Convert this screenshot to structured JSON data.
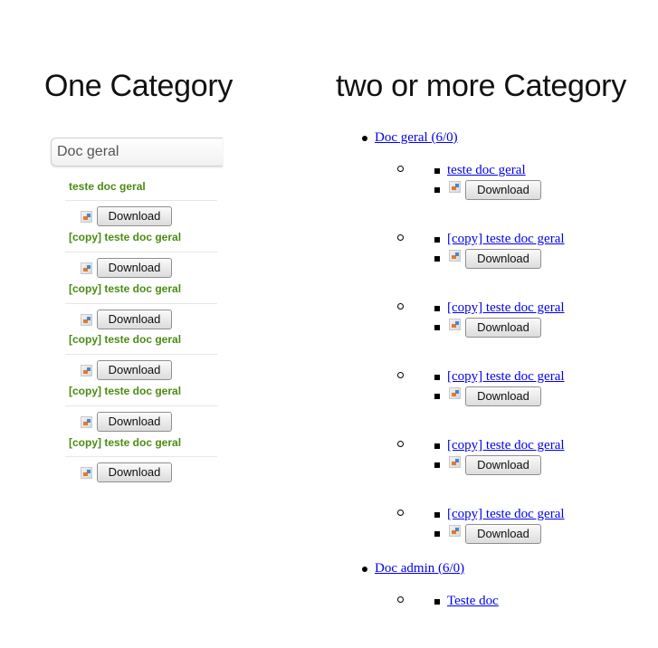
{
  "headings": {
    "one": "One Category",
    "two": "two or more Category"
  },
  "left": {
    "category": "Doc geral",
    "docs": [
      {
        "title": "teste doc geral",
        "button": "Download"
      },
      {
        "title": "[copy] teste doc geral",
        "button": "Download"
      },
      {
        "title": "[copy] teste doc geral",
        "button": "Download"
      },
      {
        "title": "[copy] teste doc geral",
        "button": "Download"
      },
      {
        "title": "[copy] teste doc geral",
        "button": "Download"
      },
      {
        "title": "[copy] teste doc geral",
        "button": "Download"
      }
    ]
  },
  "right": {
    "categories": [
      {
        "label": "Doc geral (6/0)",
        "docs": [
          {
            "title": "teste doc geral",
            "button": "Download"
          },
          {
            "title": "[copy] teste doc geral",
            "button": "Download"
          },
          {
            "title": "[copy] teste doc geral",
            "button": "Download"
          },
          {
            "title": "[copy] teste doc geral",
            "button": "Download"
          },
          {
            "title": "[copy] teste doc geral",
            "button": "Download"
          },
          {
            "title": "[copy] teste doc geral",
            "button": "Download"
          }
        ]
      },
      {
        "label": "Doc admin (6/0)",
        "docs": [
          {
            "title": "Teste doc"
          }
        ]
      }
    ]
  }
}
